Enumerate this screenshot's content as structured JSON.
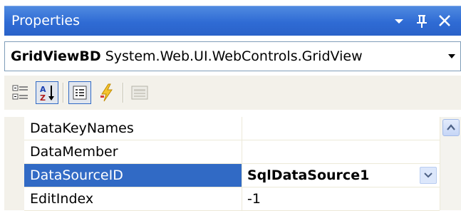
{
  "window": {
    "title": "Properties",
    "colors": {
      "titlebar": "#2f6bd4",
      "selected_row": "#316ac5",
      "accent": "#7f9db9"
    }
  },
  "titlebar_buttons": [
    {
      "icon": "dropdown-arrow-icon"
    },
    {
      "icon": "pin-icon"
    },
    {
      "icon": "close-icon"
    }
  ],
  "object_selector": {
    "name": "GridViewBD",
    "type": "System.Web.UI.WebControls.GridView"
  },
  "toolbar": {
    "buttons": [
      {
        "icon": "categorized-icon",
        "pressed": false
      },
      {
        "icon": "alphabetical-icon",
        "pressed": true
      },
      {
        "icon": "properties-icon",
        "pressed": true
      },
      {
        "icon": "events-icon",
        "pressed": false
      },
      {
        "icon": "property-pages-icon",
        "pressed": false
      }
    ]
  },
  "properties": [
    {
      "name": "DataKeyNames",
      "value": ""
    },
    {
      "name": "DataMember",
      "value": ""
    },
    {
      "name": "DataSourceID",
      "value": "SqlDataSource1",
      "selected": true
    },
    {
      "name": "EditIndex",
      "value": "-1"
    }
  ]
}
